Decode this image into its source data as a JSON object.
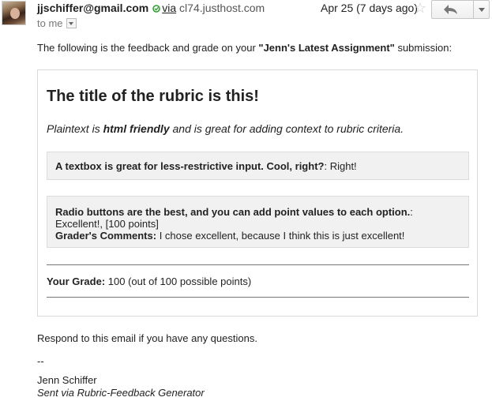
{
  "header": {
    "sender_email": "jjschiffer@gmail.com",
    "via_label": "via",
    "via_host": "cl74.justhost.com",
    "to_label": "to me",
    "date": "Apr 25 (7 days ago)",
    "icons": {
      "avatar": "avatar",
      "verified": "verified-icon",
      "star": "star-icon",
      "reply": "reply-icon",
      "more": "chevron-down-icon"
    }
  },
  "body": {
    "intro_pre": "The following is the feedback and grade on your ",
    "intro_assignment": "\"Jenn's Latest Assignment\"",
    "intro_post": " submission:",
    "rubric": {
      "title": "The title of the rubric is this!",
      "desc_pre": "Plaintext is ",
      "desc_bold": "html friendly",
      "desc_post": " and is great for adding context to rubric criteria.",
      "criteria": [
        {
          "label": "A textbox is great for less-restrictive input. Cool, right?",
          "sep": ": ",
          "answer": "Right!"
        },
        {
          "label": "Radio buttons are the best, and you can add point values to each option.",
          "sep": ":",
          "answer": "Excellent!, [100 points]",
          "comment_label": "Grader's Comments:",
          "comment": " I chose excellent, because I think this is just excellent!"
        }
      ],
      "grade_label": "Your Grade:",
      "grade_value": " 100 (out of 100 possible points)"
    },
    "respond": "Respond to this email if you have any questions.",
    "sig_dash": "--",
    "sig_name": "Jenn Schiffer",
    "sig_sent": "Sent via Rubric-Feedback Generator"
  },
  "colors": {
    "text": "#222222",
    "muted": "#777777",
    "criterion_bg": "#f1f1f1",
    "border": "#d9d9d9",
    "verified_green": "#2e9e2e",
    "star_gray": "#cccccc"
  }
}
